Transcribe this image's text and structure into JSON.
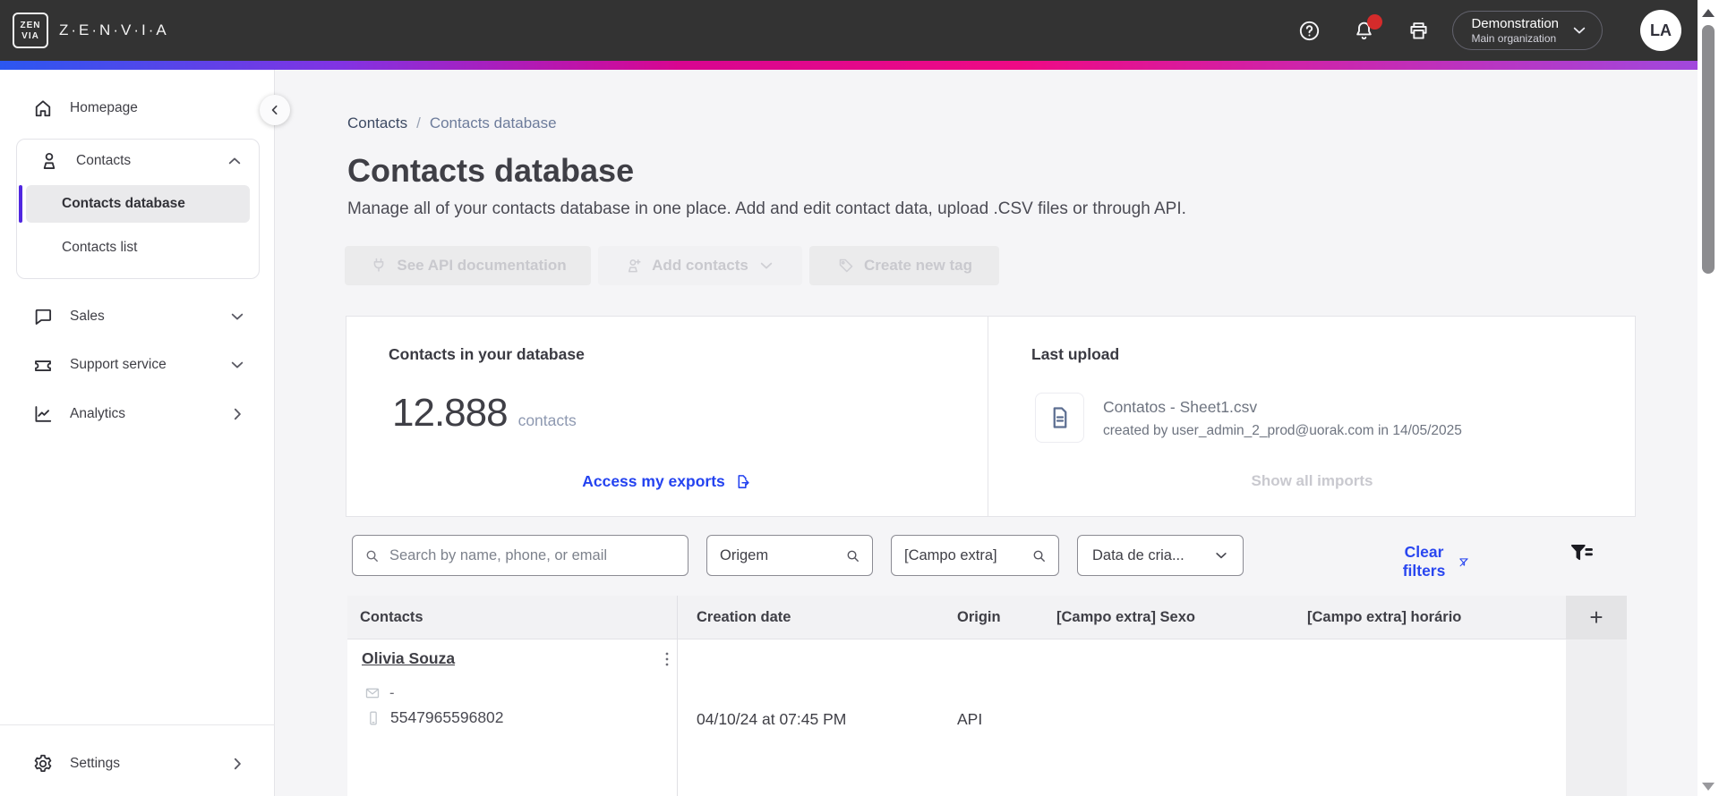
{
  "header": {
    "logo_mark_top": "ZEN",
    "logo_mark_bottom": "VIA",
    "logo_text": "Z·E·N·V·I·A",
    "org_name": "Demonstration",
    "org_sub": "Main organization",
    "avatar_initials": "LA"
  },
  "sidebar": {
    "homepage": "Homepage",
    "contacts": "Contacts",
    "contacts_database": "Contacts database",
    "contacts_list": "Contacts list",
    "sales": "Sales",
    "support_service": "Support service",
    "analytics": "Analytics",
    "settings": "Settings"
  },
  "breadcrumb": {
    "parent": "Contacts",
    "separator": "/",
    "current": "Contacts database"
  },
  "page": {
    "title": "Contacts database",
    "description": "Manage all of your contacts database in one place. Add and edit contact data, upload .CSV files or through API."
  },
  "actions": {
    "see_api_documentation": "See API documentation",
    "add_contacts": "Add contacts",
    "create_new_tag": "Create new tag"
  },
  "stats": {
    "contacts_card_title": "Contacts in your database",
    "contacts_count": "12.888",
    "contacts_unit": "contacts",
    "exports_link": "Access my exports",
    "upload_card_title": "Last upload",
    "upload_filename": "Contatos - Sheet1.csv",
    "upload_meta": "created by user_admin_2_prod@uorak.com in 14/05/2025",
    "show_all_imports": "Show all imports"
  },
  "filters": {
    "search_placeholder": "Search by name, phone, or email",
    "origin_value": "Origem",
    "campo_extra_value": "[Campo extra]",
    "creation_date_value": "Data de cria...",
    "clear_filters": "Clear filters"
  },
  "table": {
    "columns": [
      "Contacts",
      "Creation date",
      "Origin",
      "[Campo extra] Sexo",
      "[Campo extra] horário"
    ],
    "add_column_label": "+",
    "rows": [
      {
        "name": "Olivia Souza",
        "email": "-",
        "phone": "5547965596802",
        "creation_date": "04/10/24 at 07:45 PM",
        "origin": "API"
      }
    ]
  },
  "colors": {
    "topbar_bg": "#333333",
    "accent_blue": "#2946f0",
    "active_indicator": "#5127e0",
    "notification_badge": "#d42b2b",
    "gradient_stops": [
      "#2b57f0",
      "#8133e3",
      "#d80690",
      "#ee0a85",
      "#a148dd"
    ]
  }
}
